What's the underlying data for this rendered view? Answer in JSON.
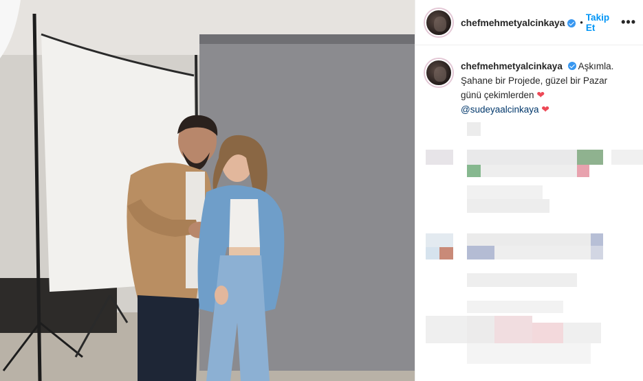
{
  "post": {
    "username": "chefmehmetyalcinkaya",
    "follow_label": "Takip Et",
    "separator": "•",
    "more_label": "•••"
  },
  "caption": {
    "username": "chefmehmetyalcinkaya",
    "line1": "Aşkımla.",
    "line2": "Şahane bir Projede, güzel bir Pazar",
    "line3": "günü çekimlerden",
    "mention": "@sudeyaalcinkaya",
    "heart": "❤"
  },
  "colors": {
    "accent": "#0095f6",
    "verified": "#3897f0",
    "heart": "#ed4956",
    "text": "#262626"
  },
  "icons": [
    "verified-badge-icon",
    "more-options-icon",
    "heart-emoji-icon"
  ]
}
